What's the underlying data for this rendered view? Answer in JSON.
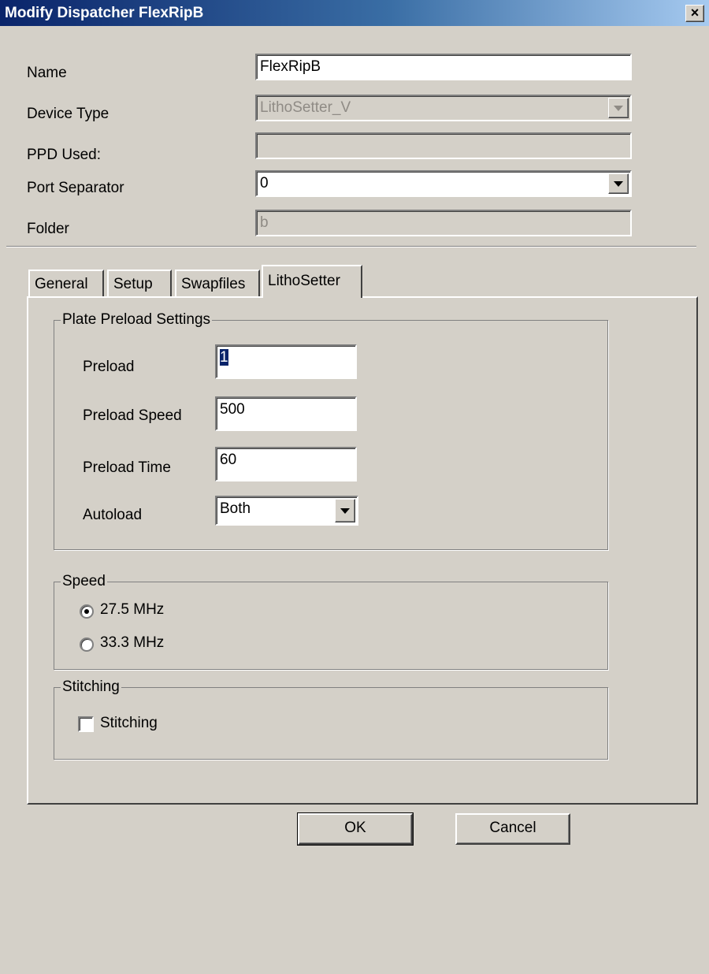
{
  "window": {
    "title": "Modify Dispatcher FlexRipB",
    "close_label": "×"
  },
  "form": {
    "name_label": "Name",
    "name_value": "FlexRipB",
    "device_type_label": "Device Type",
    "device_type_value": "LithoSetter_V",
    "ppd_label": "PPD Used:",
    "ppd_value": "",
    "port_separator_label": "Port Separator",
    "port_separator_value": "0",
    "folder_label": "Folder",
    "folder_value": "b"
  },
  "tabs": [
    {
      "label": "General"
    },
    {
      "label": "Setup"
    },
    {
      "label": "Swapfiles"
    },
    {
      "label": "LithoSetter"
    }
  ],
  "active_tab": "LithoSetter",
  "preload": {
    "group_title": "Plate Preload Settings",
    "preload_label": "Preload",
    "preload_value": "1",
    "speed_label": "Preload Speed",
    "speed_value": "500",
    "time_label": "Preload Time",
    "time_value": "60",
    "autoload_label": "Autoload",
    "autoload_value": "Both"
  },
  "speed": {
    "group_title": "Speed",
    "options": [
      {
        "label": "27.5 MHz",
        "selected": true
      },
      {
        "label": "33.3 MHz",
        "selected": false
      }
    ]
  },
  "stitching": {
    "group_title": "Stitching",
    "checkbox_label": "Stitching",
    "checked": false
  },
  "buttons": {
    "ok": "OK",
    "cancel": "Cancel"
  },
  "colors": {
    "title_start": "#0a246a",
    "title_end": "#a6caf0",
    "face": "#d4d0c8"
  }
}
